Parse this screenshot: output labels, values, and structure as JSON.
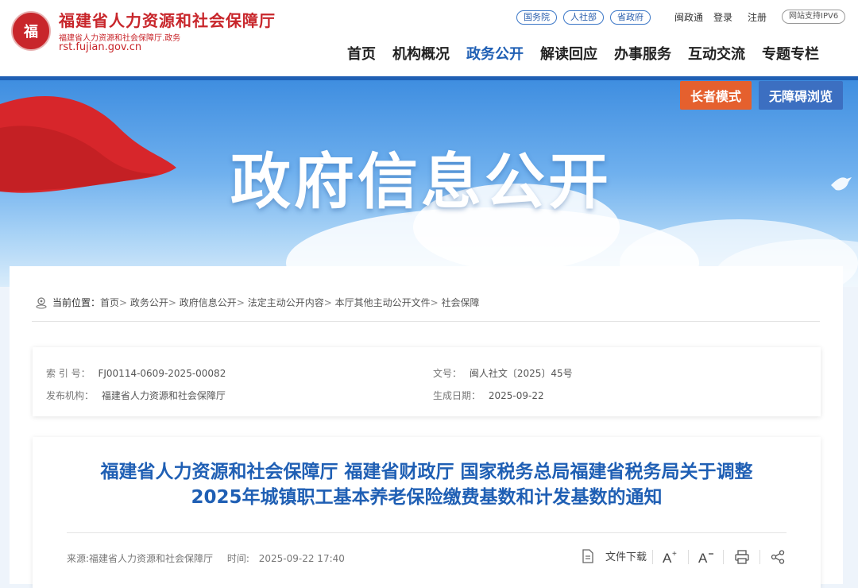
{
  "header": {
    "emblem_text": "福",
    "site_title": "福建省人力资源和社会保障厅",
    "site_subtitle": "福建省人力资源和社会保障厅.政务",
    "domain": "rst.fujian.gov.cn",
    "top_links": [
      "国务院",
      "人社部",
      "省政府"
    ],
    "util_links": {
      "minzhengtong": "闽政通",
      "login": "登录",
      "register": "注册"
    },
    "ipv6": "网站支持IPV6",
    "nav": [
      "首页",
      "机构概况",
      "政务公开",
      "解读回应",
      "办事服务",
      "互动交流",
      "专题专栏"
    ],
    "nav_active": "政务公开"
  },
  "banner": {
    "title": "政府信息公开",
    "elder_mode": "长者模式",
    "accessible": "无障碍浏览"
  },
  "breadcrumb": {
    "label": "当前位置：",
    "items": [
      "首页",
      "政务公开",
      "政府信息公开",
      "法定主动公开内容",
      "本厅其他主动公开文件",
      "社会保障"
    ]
  },
  "meta": {
    "index_label": "索 引 号：",
    "index_value": "FJ00114-0609-2025-00082",
    "doc_label": "文号：",
    "doc_value": "闽人社文〔2025〕45号",
    "publisher_label": "发布机构：",
    "publisher_value": "福建省人力资源和社会保障厅",
    "date_label": "生成日期：",
    "date_value": "2025-09-22"
  },
  "article": {
    "title_line1": "福建省人力资源和社会保障厅 福建省财政厅 国家税务总局福建省税务局关于调整",
    "title_line2": "2025年城镇职工基本养老保险缴费基数和计发基数的通知",
    "source": "来源:福建省人力资源和社会保障厅",
    "time_label": "时间:",
    "time_value": "2025-09-22 17:40",
    "download": "文件下载"
  }
}
